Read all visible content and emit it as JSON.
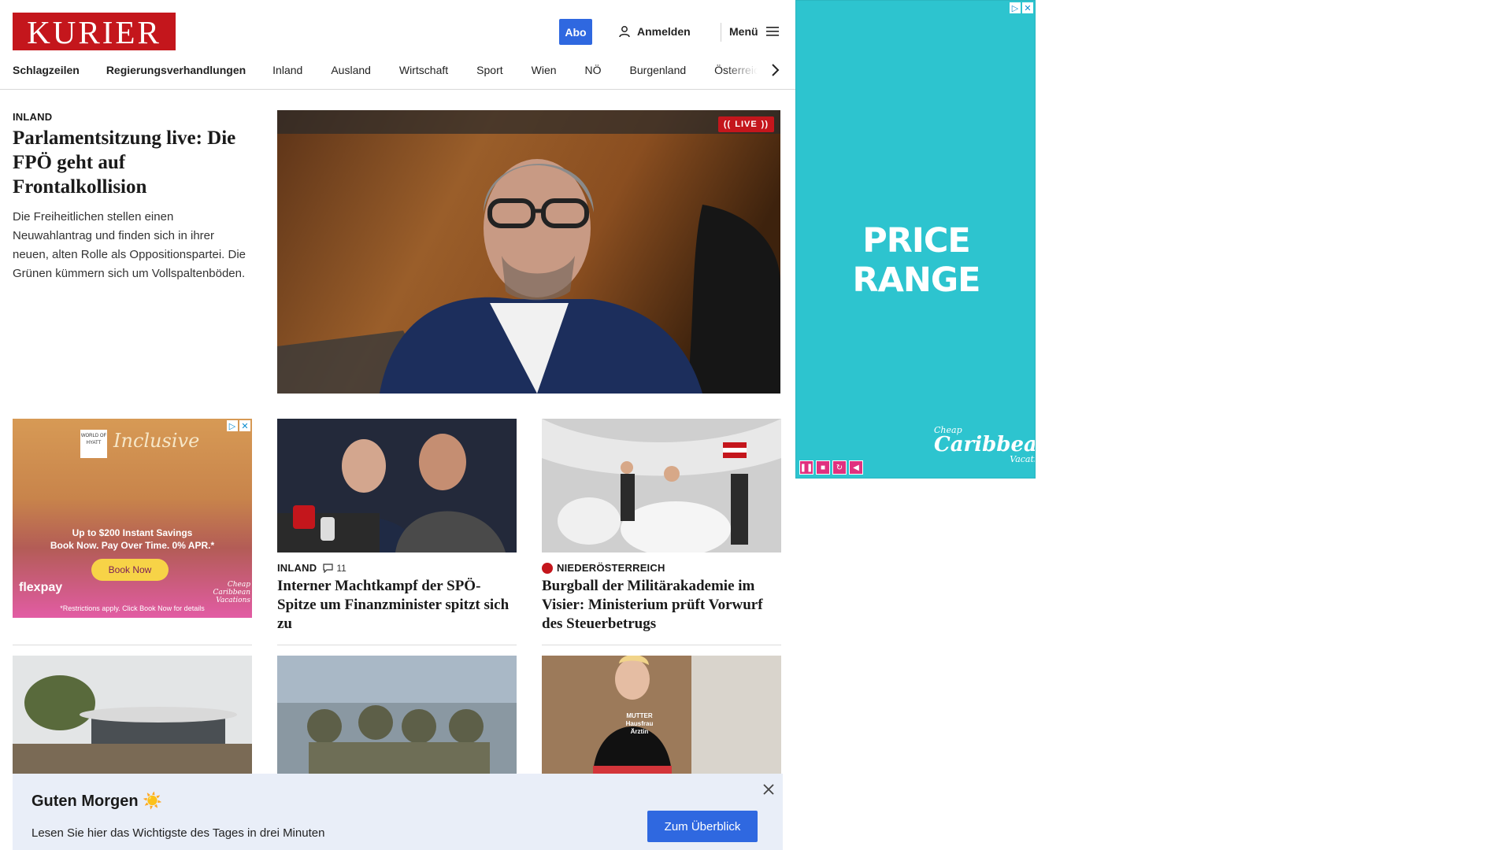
{
  "header": {
    "logo": "KURIER",
    "abo_label": "Abo",
    "login_label": "Anmelden",
    "menu_label": "Menü"
  },
  "nav": {
    "items": [
      {
        "label": "Schlagzeilen"
      },
      {
        "label": "Regierungsverhandlungen"
      },
      {
        "label": "Inland"
      },
      {
        "label": "Ausland"
      },
      {
        "label": "Wirtschaft"
      },
      {
        "label": "Sport"
      },
      {
        "label": "Wien"
      },
      {
        "label": "NÖ"
      },
      {
        "label": "Burgenland"
      },
      {
        "label": "Österreich"
      }
    ]
  },
  "hero": {
    "kicker": "INLAND",
    "title": "Parlamentsitzung live: Die FPÖ geht auf Frontalkollision",
    "text": "Die Freiheitlichen stellen einen Neuwahlantrag und finden sich in ihrer neuen, alten Rolle als Oppositionspartei. Die Grünen kümmern sich um Vollspaltenböden.",
    "live_label": "LIVE"
  },
  "ad_small": {
    "brand_top": "WORLD OF HYATT",
    "script": "Inclusive",
    "headline": "Up to $200 Instant Savings",
    "subline": "Book Now. Pay Over Time. 0% APR.*",
    "button": "Book Now",
    "flexpay": "flexpay",
    "footer": "*Restrictions apply. Click Book Now for details",
    "brand_logo": "Cheap Caribbean Vacations"
  },
  "cards": [
    {
      "kicker": "INLAND",
      "comments": "11",
      "title": "Interner Machtkampf der SPÖ-Spitze um Finanzminister spitzt sich zu"
    },
    {
      "kicker": "NIEDERÖSTERREICH",
      "title": "Burgball der Militärakademie im Visier: Ministerium prüft Vorwurf des Steuerbetrugs"
    }
  ],
  "bottom_row": {
    "shirt_text": "MUTTER Hausfrau Ärztin"
  },
  "toast": {
    "title": "Guten Morgen ☀️",
    "text": "Lesen Sie hier das Wichtigste des Tages in drei Minuten",
    "button": "Zum Überblick"
  },
  "ad_big": {
    "headline": "PRICE RANGE",
    "logo_top": "Cheap",
    "logo_main": "Caribbean",
    "logo_bottom": "Vacations"
  },
  "colors": {
    "brand_red": "#c4161c",
    "accent_blue": "#2f68e0",
    "ad_teal": "#2dc4cf",
    "toast_bg": "#e9eef8"
  }
}
